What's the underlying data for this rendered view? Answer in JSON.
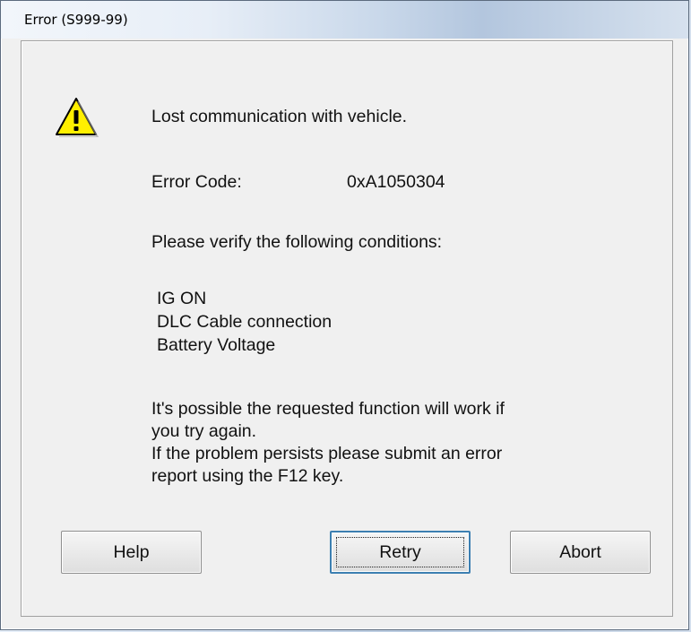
{
  "window": {
    "title": "Error (S999-99)"
  },
  "icon": {
    "name": "warning-icon",
    "fill": "#ffef00",
    "stroke": "#000000"
  },
  "message": {
    "headline": "Lost communication with vehicle.",
    "error_code_label": "Error Code:",
    "error_code_value": "0xA1050304",
    "verify_prompt": "Please verify the following conditions:",
    "conditions": [
      "IG ON",
      "DLC Cable connection",
      "Battery Voltage"
    ],
    "retry_line_1": "It's possible the requested function will work if",
    "retry_line_2": "you try again.",
    "report_line_1": "If the problem persists please submit an error",
    "report_line_2": "report using the F12 key."
  },
  "buttons": {
    "help": "Help",
    "retry": "Retry",
    "abort": "Abort"
  },
  "colors": {
    "focus_border": "#3c7fb1",
    "dialog_bg": "#f0f0f0"
  }
}
